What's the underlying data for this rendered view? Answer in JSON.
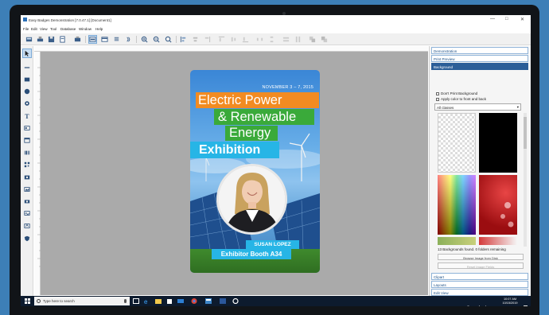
{
  "window": {
    "title": "Easy Badges Demonstration [7.0.47.1] [Document1]",
    "minimize": "—",
    "maximize": "□",
    "close": "✕"
  },
  "menu": [
    "File",
    "Edit",
    "View",
    "Tool",
    "Database",
    "Window",
    "Help"
  ],
  "badge": {
    "date": "NOVEMBER 3 – 7, 2015",
    "line1": "Electric Power",
    "line2": "& Renewable",
    "line3": "Energy",
    "line4": "Exhibition",
    "name": "SUSAN LOPEZ",
    "booth": "Exhibitor Booth A34"
  },
  "right_panel": {
    "sections_top": [
      "Demonstration",
      "Print Preview",
      "Background"
    ],
    "selected_section": "Background",
    "options": {
      "dont_print": "Don't Print Background",
      "apply_both": "Apply color to front and back"
    },
    "category_select": "All classes",
    "status": "13 Backgrounds found. 0 folders remaining",
    "browse_button": "Browse Image from Disk",
    "reset_button": "Reset Image Fields",
    "sections_bottom": [
      "Clipart",
      "Layouts",
      "Edit View",
      "Zoom"
    ]
  },
  "taskbar": {
    "search_placeholder": "Type here to search",
    "time": "10:07 AM",
    "date": "10/15/2019"
  },
  "colors": {
    "accent_orange": "#f28b22",
    "accent_green": "#3aaa3a",
    "accent_cyan": "#27b5e6",
    "panel_selected": "#2b5e98"
  }
}
